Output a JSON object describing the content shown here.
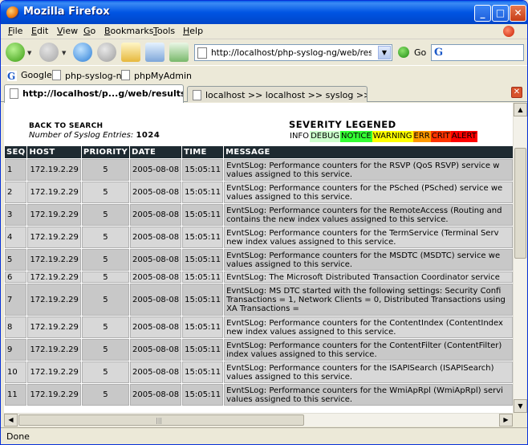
{
  "window": {
    "title": "Mozilla Firefox"
  },
  "menu": [
    {
      "label": "File",
      "key": "F",
      "rest": "ile"
    },
    {
      "label": "Edit",
      "key": "E",
      "rest": "dit"
    },
    {
      "label": "View",
      "key": "V",
      "rest": "iew"
    },
    {
      "label": "Go",
      "key": "G",
      "rest": "o"
    },
    {
      "label": "Bookmarks",
      "key": "B",
      "rest": "ookmarks"
    },
    {
      "label": "Tools",
      "key": "T",
      "rest": "ools"
    },
    {
      "label": "Help",
      "key": "H",
      "rest": "elp"
    }
  ],
  "nav": {
    "url": "http://localhost/php-syslog-ng/web/results.php",
    "go_label": "Go",
    "search_placeholder": ""
  },
  "bookmarks": [
    "Google",
    "php-syslog-ng",
    "phpMyAdmin"
  ],
  "tabs": {
    "active": "http://localhost/p...g/web/results.php",
    "inactive": "localhost >> localhost >> syslog  >> logs |..."
  },
  "status": "Done",
  "page": {
    "back_link": "BACK TO SEARCH",
    "entries_label": "Number of Syslog Entries:",
    "entries_count": "1024",
    "severity_title": "SEVERITY LEGENED",
    "legend": [
      {
        "label": "INFO",
        "bg": "#ffffff"
      },
      {
        "label": "DEBUG",
        "bg": "#ccffcc"
      },
      {
        "label": "NOTICE",
        "bg": "#33ff33"
      },
      {
        "label": "WARNING",
        "bg": "#ffff00"
      },
      {
        "label": "ERR",
        "bg": "#ff9900"
      },
      {
        "label": "CRIT",
        "bg": "#ff3300"
      },
      {
        "label": "ALERT",
        "bg": "#ff0000"
      }
    ],
    "columns": [
      "SEQ",
      "HOST",
      "PRIORITY",
      "DATE",
      "TIME",
      "MESSAGE"
    ],
    "rows": [
      {
        "seq": "1",
        "host": "172.19.2.29",
        "priority": "5",
        "date": "2005-08-08",
        "time": "15:05:11",
        "msg": [
          "EvntSLog: Performance counters for the RSVP (QoS RSVP) service w",
          "values assigned to this service."
        ]
      },
      {
        "seq": "2",
        "host": "172.19.2.29",
        "priority": "5",
        "date": "2005-08-08",
        "time": "15:05:11",
        "msg": [
          "EvntSLog: Performance counters for the PSched (PSched) service we",
          "values assigned to this service."
        ]
      },
      {
        "seq": "3",
        "host": "172.19.2.29",
        "priority": "5",
        "date": "2005-08-08",
        "time": "15:05:11",
        "msg": [
          "EvntSLog: Performance counters for the RemoteAccess (Routing and",
          "contains the new index values assigned to this service."
        ]
      },
      {
        "seq": "4",
        "host": "172.19.2.29",
        "priority": "5",
        "date": "2005-08-08",
        "time": "15:05:11",
        "msg": [
          "EvntSLog: Performance counters for the TermService (Terminal Serv",
          "new index values assigned to this service."
        ]
      },
      {
        "seq": "5",
        "host": "172.19.2.29",
        "priority": "5",
        "date": "2005-08-08",
        "time": "15:05:11",
        "msg": [
          "EvntSLog: Performance counters for the MSDTC (MSDTC) service we",
          "values assigned to this service."
        ]
      },
      {
        "seq": "6",
        "host": "172.19.2.29",
        "priority": "5",
        "date": "2005-08-08",
        "time": "15:05:11",
        "msg": [
          "EvntSLog: The Microsoft Distributed Transaction Coordinator service"
        ]
      },
      {
        "seq": "7",
        "host": "172.19.2.29",
        "priority": "5",
        "date": "2005-08-08",
        "time": "15:05:11",
        "msg": [
          "EvntSLog: MS DTC started with the following settings: Security Confi",
          "Transactions = 1, Network Clients = 0, Distributed Transactions using",
          "XA Transactions ="
        ]
      },
      {
        "seq": "8",
        "host": "172.19.2.29",
        "priority": "5",
        "date": "2005-08-08",
        "time": "15:05:11",
        "msg": [
          "EvntSLog: Performance counters for the ContentIndex (ContentIndex",
          "new index values assigned to this service."
        ]
      },
      {
        "seq": "9",
        "host": "172.19.2.29",
        "priority": "5",
        "date": "2005-08-08",
        "time": "15:05:11",
        "msg": [
          "EvntSLog: Performance counters for the ContentFilter (ContentFilter)",
          "index values assigned to this service."
        ]
      },
      {
        "seq": "10",
        "host": "172.19.2.29",
        "priority": "5",
        "date": "2005-08-08",
        "time": "15:05:11",
        "msg": [
          "EvntSLog: Performance counters for the ISAPISearch (ISAPISearch)",
          "values assigned to this service."
        ]
      },
      {
        "seq": "11",
        "host": "172.19.2.29",
        "priority": "5",
        "date": "2005-08-08",
        "time": "15:05:11",
        "msg": [
          "EvntSLog: Performance counters for the WmiApRpl (WmiApRpl) servi",
          "values assigned to this service."
        ]
      }
    ]
  }
}
